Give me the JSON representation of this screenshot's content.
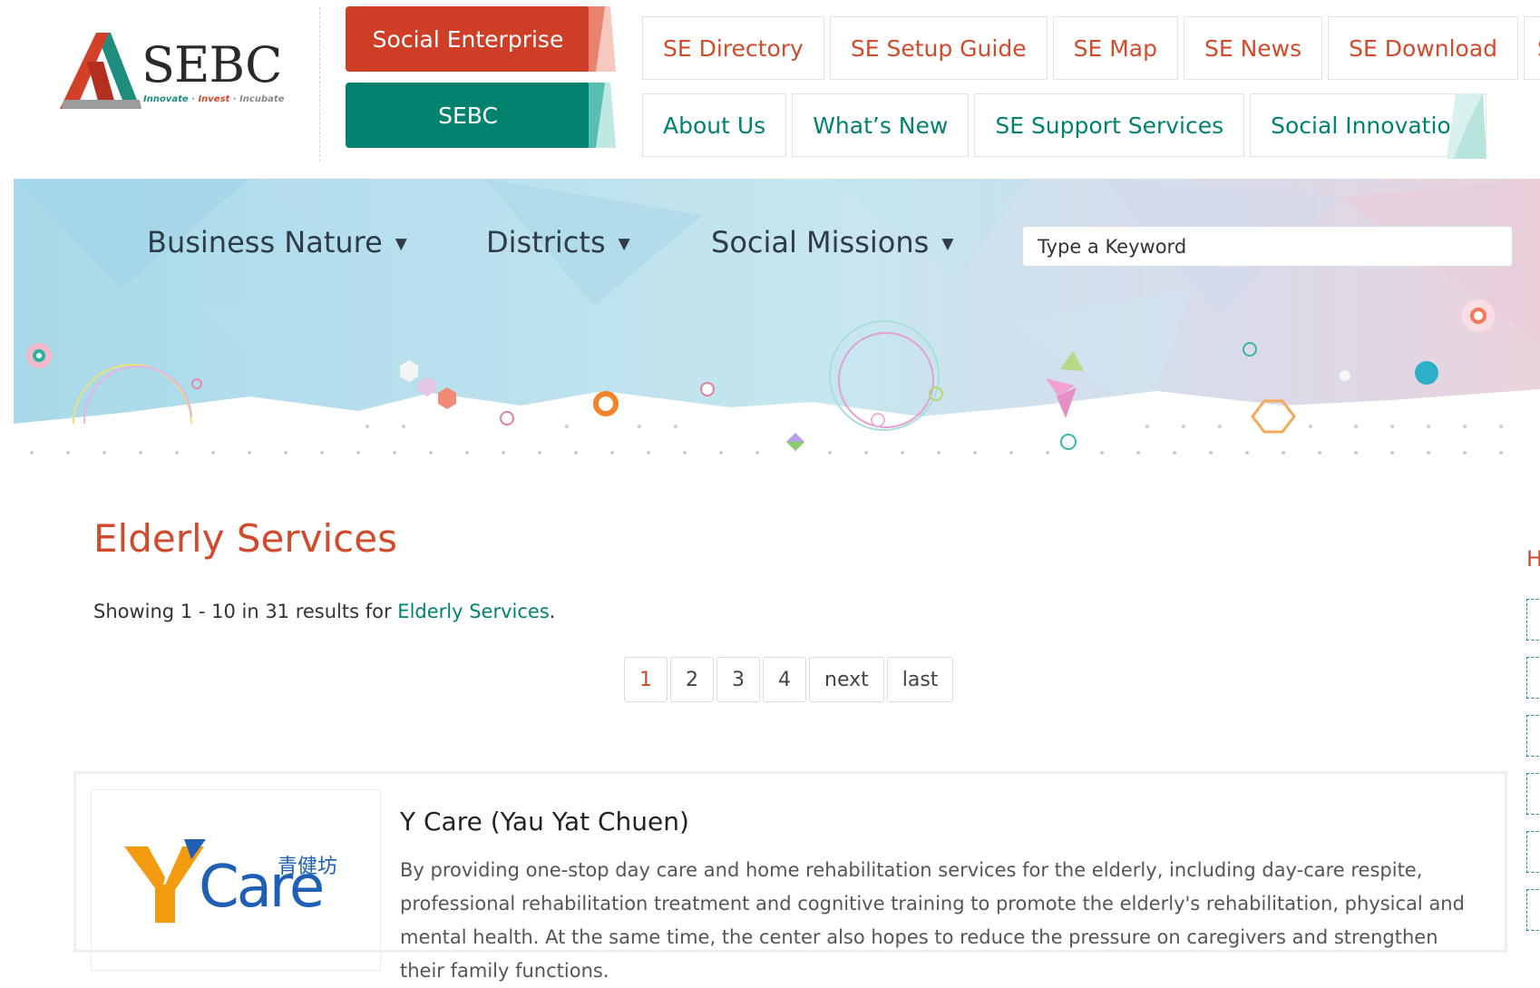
{
  "brand": {
    "wordmark": "SEBC",
    "tagline_innovate": "Innovate",
    "tagline_invest": "Invest",
    "tagline_incubate": "Incubate",
    "sep": " · "
  },
  "mode_switch": {
    "social_enterprise": "Social Enterprise",
    "sebc": "SEBC"
  },
  "nav": {
    "row1": [
      "SE Directory",
      "SE Setup Guide",
      "SE Map",
      "SE News",
      "SE Download",
      "SE"
    ],
    "row2": [
      "About Us",
      "What’s New",
      "SE Support Services",
      "Social Innovation"
    ]
  },
  "filters": {
    "business_nature": "Business Nature",
    "districts": "Districts",
    "social_missions": "Social Missions",
    "caret": "▼"
  },
  "search": {
    "placeholder": "Type a Keyword"
  },
  "listing": {
    "title": "Elderly Services",
    "result_prefix": "Showing 1 - 10 in 31 results for ",
    "result_category": "Elderly Services",
    "result_suffix": "."
  },
  "pagination": {
    "pages": [
      "1",
      "2",
      "3",
      "4"
    ],
    "current": "1",
    "next": "next",
    "last": "last"
  },
  "results": [
    {
      "name": "Y Care (Yau Yat Chuen)",
      "logo_word": "Care",
      "logo_cn": "青健坊",
      "description": "By providing one-stop day care and home rehabilitation services for the elderly, including day-care respite, professional rehabilitation treatment and cognitive training to promote the elderly's rehabilitation, physical and mental health. At the same time, the center also hopes to reduce the pressure on caregivers and strengthen their family functions."
    }
  ],
  "sidebar": {
    "heading_fragment": "H"
  },
  "colors": {
    "brand_red": "#d24a2c",
    "brand_teal": "#00826f",
    "se_button": "#cf3e26",
    "logo_orange": "#f39c12",
    "logo_blue": "#1f5fb6"
  }
}
